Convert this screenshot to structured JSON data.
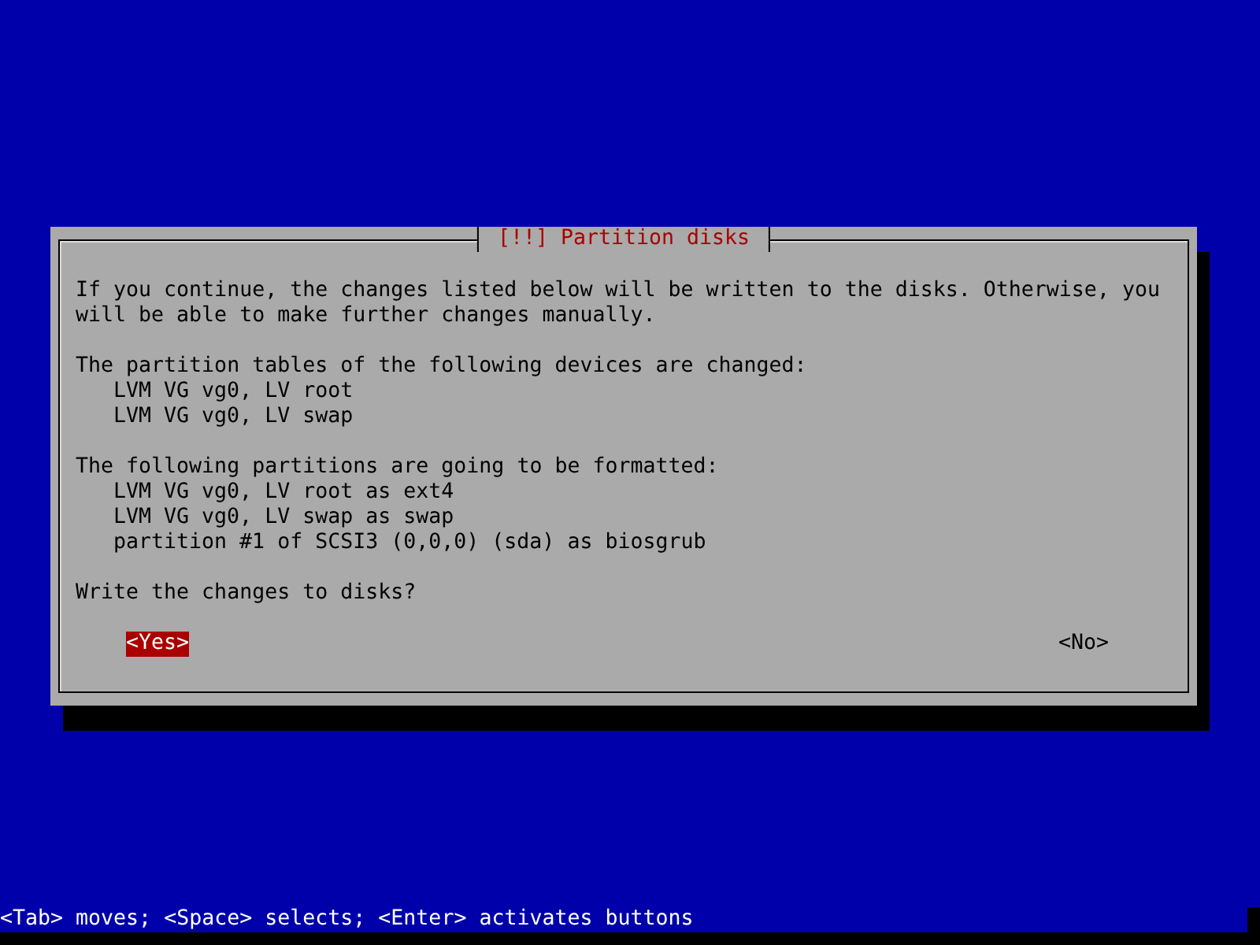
{
  "dialog": {
    "title": "[!!] Partition disks",
    "message": "If you continue, the changes listed below will be written to the disks. Otherwise, you will be able to make further changes manually.",
    "sections": [
      {
        "heading": "The partition tables of the following devices are changed:",
        "items": [
          "LVM VG vg0, LV root",
          "LVM VG vg0, LV swap"
        ]
      },
      {
        "heading": "The following partitions are going to be formatted:",
        "items": [
          "LVM VG vg0, LV root as ext4",
          "LVM VG vg0, LV swap as swap",
          "partition #1 of SCSI3 (0,0,0) (sda) as biosgrub"
        ]
      }
    ],
    "question": "Write the changes to disks?",
    "buttons": [
      {
        "label": "<Yes>",
        "selected": true
      },
      {
        "label": "<No>",
        "selected": false
      }
    ]
  },
  "status_bar": "<Tab> moves; <Space> selects; <Enter> activates buttons"
}
